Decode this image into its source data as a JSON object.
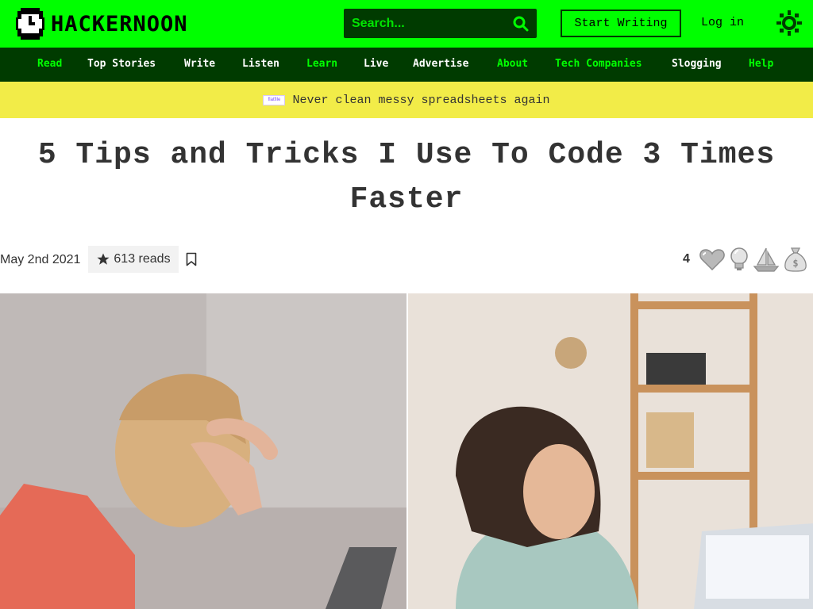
{
  "header": {
    "logo_text": "HACKERNOON",
    "search_placeholder": "Search...",
    "start_writing": "Start Writing",
    "login": "Log in"
  },
  "nav": [
    {
      "label": "Read",
      "color": "#00ff00"
    },
    {
      "label": "Top Stories",
      "color": "#ffffff"
    },
    {
      "label": "Write",
      "color": "#ffffff"
    },
    {
      "label": "Listen",
      "color": "#ffffff"
    },
    {
      "label": "Learn",
      "color": "#00ff00"
    },
    {
      "label": "Live",
      "color": "#ffffff"
    },
    {
      "label": "Advertise",
      "color": "#ffffff"
    },
    {
      "label": "About",
      "color": "#00ff00"
    },
    {
      "label": "Tech Companies",
      "color": "#00ff00"
    },
    {
      "label": "Slogging",
      "color": "#ffffff"
    },
    {
      "label": "Help",
      "color": "#00ff00"
    }
  ],
  "promo": {
    "logo_text": "flatfile",
    "text": "Never clean messy spreadsheets again"
  },
  "article": {
    "title": "5 Tips and Tricks I Use To Code 3 Times Faster",
    "date": "May 2nd 2021",
    "reads": "613 reads",
    "reaction_count": "4"
  },
  "reactions": [
    "heart-icon",
    "lightbulb-icon",
    "boat-icon",
    "money-bag-icon"
  ],
  "colors": {
    "brand_green": "#00ff00",
    "dark_green": "#003b00",
    "promo_yellow": "#f2ec48",
    "text": "#333333"
  }
}
